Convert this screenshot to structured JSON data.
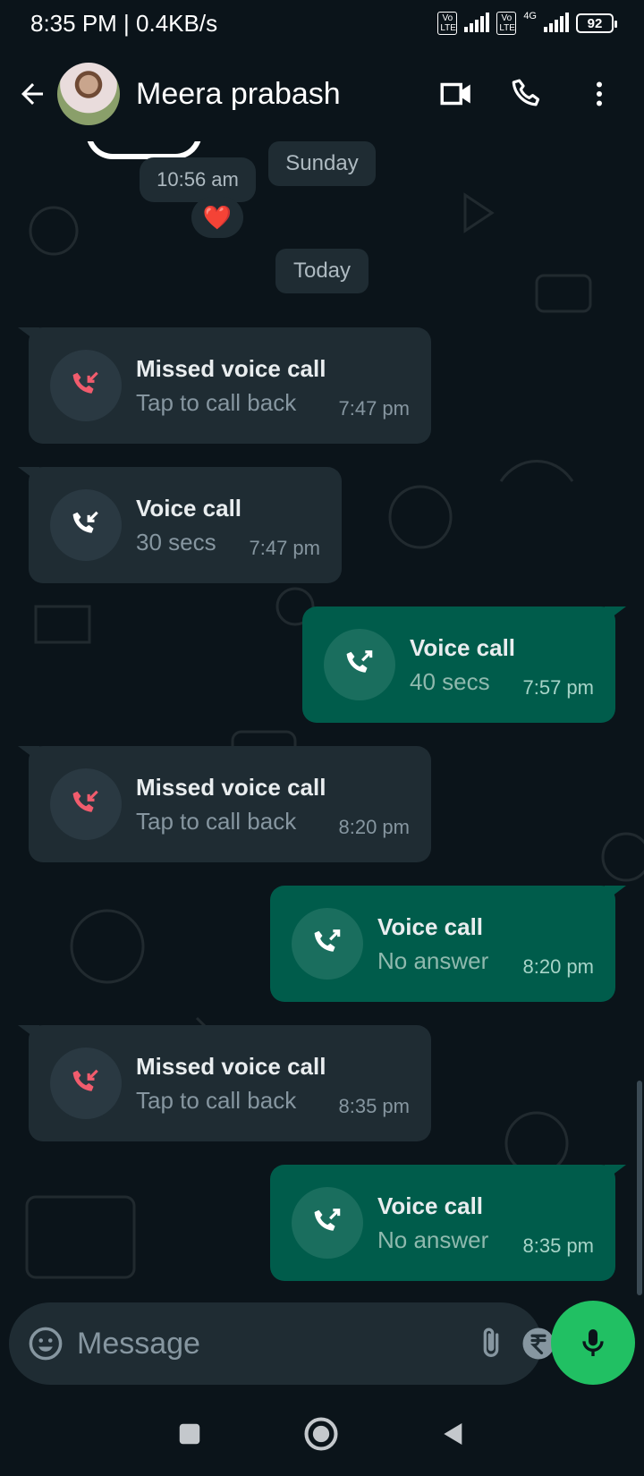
{
  "status_bar": {
    "time_speed": "8:35 PM | 0.4KB/s",
    "lte_badge": "Vo LTE",
    "network": "4G",
    "battery": "92"
  },
  "header": {
    "contact_name": "Meera prabash"
  },
  "chat": {
    "time_pill": "10:56 am",
    "reaction": "❤️",
    "date_chips": [
      "Sunday",
      "Today"
    ],
    "messages": [
      {
        "direction": "in",
        "title": "Missed voice call",
        "subtitle": "Tap to call back",
        "time": "7:47 pm",
        "status": "missed"
      },
      {
        "direction": "in",
        "title": "Voice call",
        "subtitle": "30 secs",
        "time": "7:47 pm",
        "status": "incoming"
      },
      {
        "direction": "out",
        "title": "Voice call",
        "subtitle": "40 secs",
        "time": "7:57 pm",
        "status": "outgoing"
      },
      {
        "direction": "in",
        "title": "Missed voice call",
        "subtitle": "Tap to call back",
        "time": "8:20 pm",
        "status": "missed"
      },
      {
        "direction": "out",
        "title": "Voice call",
        "subtitle": "No answer",
        "time": "8:20 pm",
        "status": "outgoing"
      },
      {
        "direction": "in",
        "title": "Missed voice call",
        "subtitle": "Tap to call back",
        "time": "8:35 pm",
        "status": "missed"
      },
      {
        "direction": "out",
        "title": "Voice call",
        "subtitle": "No answer",
        "time": "8:35 pm",
        "status": "outgoing"
      }
    ]
  },
  "input": {
    "placeholder": "Message"
  },
  "colors": {
    "background": "#0b141a",
    "incoming_bubble": "#1f2c33",
    "outgoing_bubble": "#005c4b",
    "missed_icon": "#f15c6d",
    "mic_button": "#21c063"
  },
  "icons": {
    "header": [
      "back-arrow-icon",
      "video-call-icon",
      "phone-icon",
      "more-vert-icon"
    ],
    "input": [
      "emoji-icon",
      "attach-icon",
      "rupee-icon",
      "camera-icon",
      "mic-icon"
    ],
    "nav": [
      "recent-apps-icon",
      "home-icon",
      "back-icon"
    ]
  }
}
